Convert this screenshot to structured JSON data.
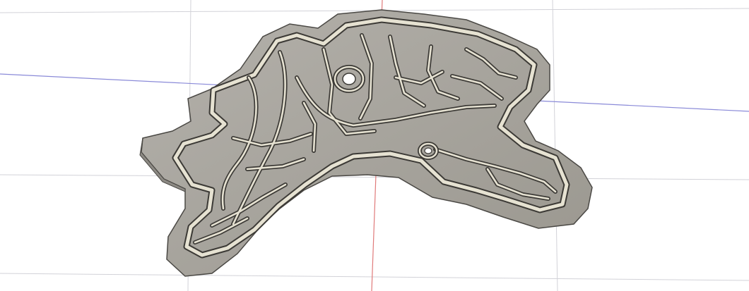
{
  "viewport": {
    "background": "#ffffff",
    "grid_color": "#d2d2d8",
    "axis_x_color": "#8a8ad8",
    "axis_y_color": "#e07a7a"
  },
  "model": {
    "base_fill": "#a9a6a0",
    "base_edge": "#4a4844",
    "wall_top_fill": "#e6e2d2",
    "wall_edge": "#3c3a36",
    "shadow": "#8d8a84"
  }
}
